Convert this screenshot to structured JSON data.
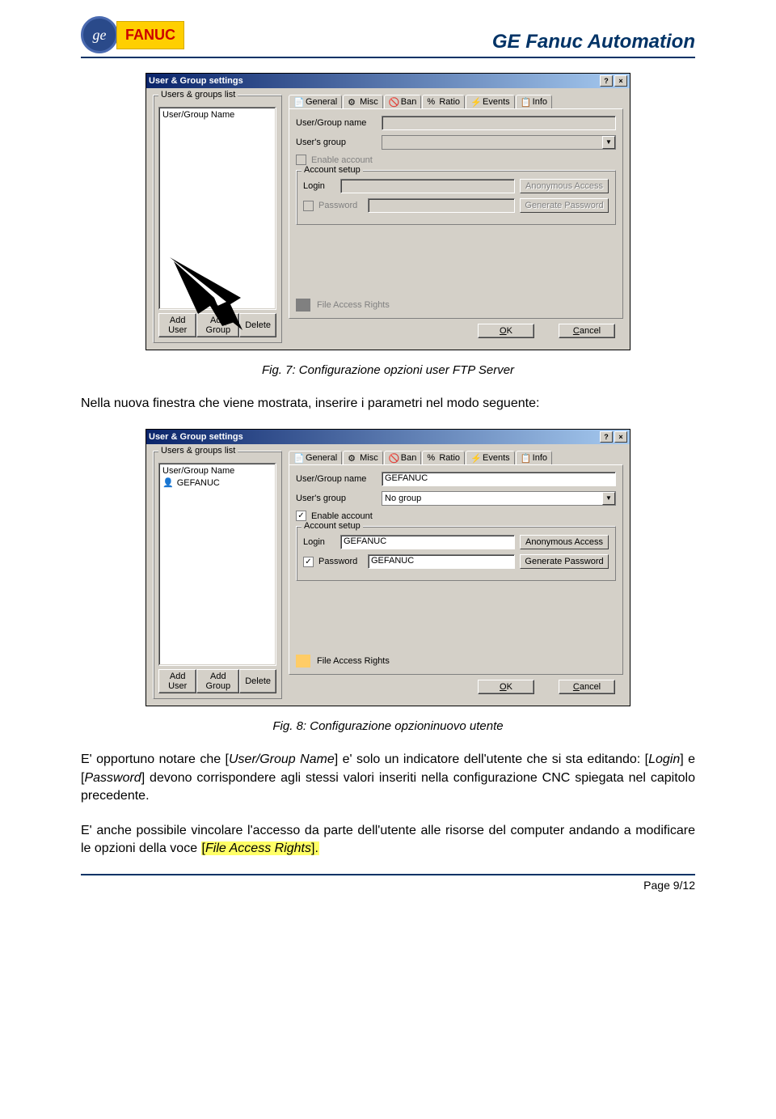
{
  "header": {
    "ge_monogram": "ge",
    "fanuc": "FANUC",
    "title": "GE Fanuc Automation"
  },
  "screenshot1": {
    "title": "User & Group settings",
    "groups_label": "Users & groups list",
    "list_header": "User/Group Name",
    "buttons": {
      "add_user": "Add User",
      "add_group": "Add Group",
      "delete": "Delete"
    },
    "tabs": {
      "general": "General",
      "misc": "Misc",
      "ban": "Ban",
      "ratio": "Ratio",
      "events": "Events",
      "info": "Info"
    },
    "form": {
      "name_label": "User/Group name",
      "group_label": "User's group",
      "enable_label": "Enable account",
      "account_setup": "Account setup",
      "login_label": "Login",
      "password_label": "Password",
      "anonymous": "Anonymous Access",
      "generate": "Generate Password",
      "file_access": "File Access Rights"
    },
    "footer": {
      "ok": "OK",
      "cancel": "Cancel"
    }
  },
  "caption1": "Fig. 7: Configurazione opzioni user FTP Server",
  "paragraph1": "Nella nuova finestra che viene mostrata, inserire i parametri nel modo seguente:",
  "screenshot2": {
    "title": "User & Group settings",
    "groups_label": "Users & groups list",
    "list_header": "User/Group Name",
    "listitem": "GEFANUC",
    "buttons": {
      "add_user": "Add User",
      "add_group": "Add Group",
      "delete": "Delete"
    },
    "tabs": {
      "general": "General",
      "misc": "Misc",
      "ban": "Ban",
      "ratio": "Ratio",
      "events": "Events",
      "info": "Info"
    },
    "form": {
      "name_label": "User/Group name",
      "name_value": "GEFANUC",
      "group_label": "User's group",
      "group_value": "No group",
      "enable_label": "Enable account",
      "account_setup": "Account setup",
      "login_label": "Login",
      "login_value": "GEFANUC",
      "password_label": "Password",
      "password_value": "GEFANUC",
      "anonymous": "Anonymous Access",
      "generate": "Generate Password",
      "file_access": "File Access Rights"
    },
    "footer": {
      "ok": "OK",
      "cancel": "Cancel"
    }
  },
  "caption2": "Fig. 8: Configurazione opzioninuovo utente",
  "paragraph2_a": "E' opportuno notare che [",
  "paragraph2_b": "User/Group Name",
  "paragraph2_c": "] e' solo un indicatore dell'utente che si sta editando: [",
  "paragraph2_d": "Login",
  "paragraph2_e": "] e [",
  "paragraph2_f": "Password",
  "paragraph2_g": "] devono corrispondere agli stessi valori inseriti nella configurazione CNC spiegata nel capitolo precedente.",
  "paragraph3_a": "E' anche possibile vincolare l'accesso da parte dell'utente alle risorse del computer andando a modificare le opzioni della voce ",
  "paragraph3_b": "[",
  "paragraph3_c": "File Access Rights",
  "paragraph3_d": "].",
  "footer": {
    "page": "Page 9/12"
  }
}
